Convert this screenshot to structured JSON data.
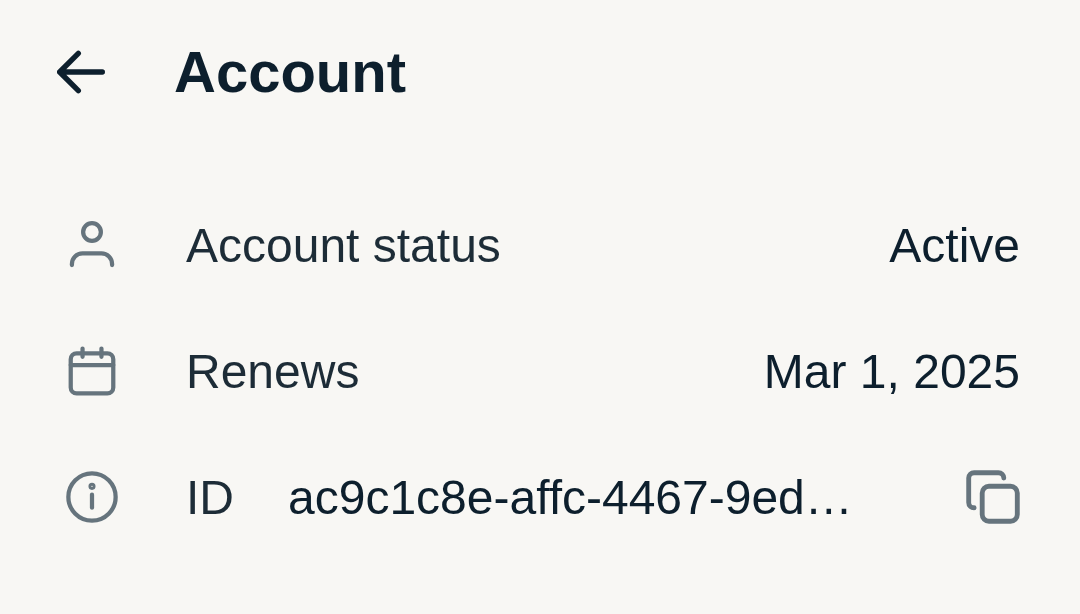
{
  "header": {
    "title": "Account"
  },
  "rows": [
    {
      "kind": "status",
      "label": "Account status",
      "value": "Active",
      "copyable": false
    },
    {
      "kind": "date",
      "label": "Renews",
      "value": "Mar 1, 2025",
      "copyable": false
    },
    {
      "kind": "id",
      "label": "ID",
      "value": "ac9c1c8e-affc-4467-9ed…",
      "copyable": true
    }
  ]
}
